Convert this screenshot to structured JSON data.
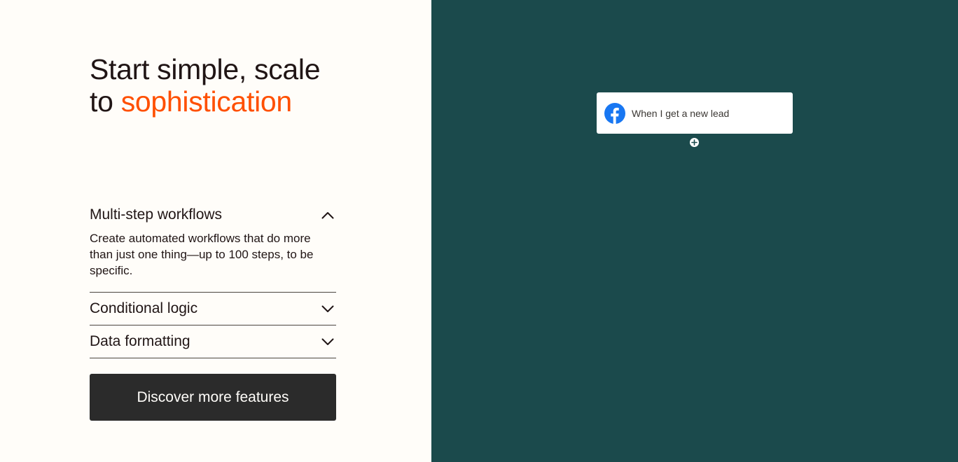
{
  "hero": {
    "headline_prefix": "Start simple, scale\nto ",
    "headline_accent": "sophistication",
    "accent_color": "#ff4f00"
  },
  "accordion": {
    "items": [
      {
        "title": "Multi-step workflows",
        "expanded": true,
        "icon": "chevron-up-icon",
        "body": "Create automated workflows that do more than just one thing—up to 100 steps, to be specific."
      },
      {
        "title": "Conditional logic",
        "expanded": false,
        "icon": "chevron-down-icon"
      },
      {
        "title": "Data formatting",
        "expanded": false,
        "icon": "chevron-down-icon"
      }
    ]
  },
  "cta": {
    "label": "Discover more features"
  },
  "workflow": {
    "trigger": {
      "icon": "facebook-icon",
      "label": "When I get a new lead"
    },
    "add_step_icon": "plus-icon",
    "background_color": "#1b4a4c"
  }
}
